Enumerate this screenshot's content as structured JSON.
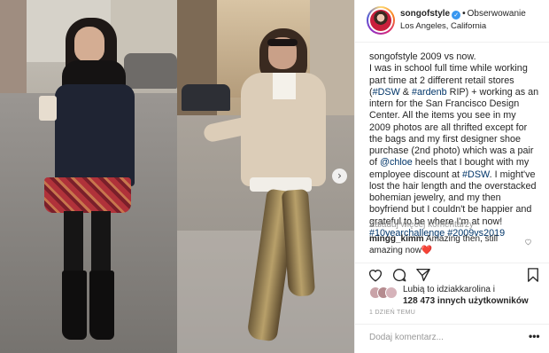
{
  "post": {
    "username": "songofstyle",
    "follow_label": "Obserwowanie",
    "location": "Los Angeles, California",
    "caption_lines": [
      {
        "parts": [
          {
            "t": "songofstyle 2009 vs now."
          }
        ]
      },
      {
        "parts": [
          {
            "t": "I was in school full time while working"
          }
        ]
      },
      {
        "parts": [
          {
            "t": "part time at 2 different retail stores"
          }
        ]
      },
      {
        "parts": [
          {
            "t": "("
          },
          {
            "t": "#DSW",
            "link": true
          },
          {
            "t": " & "
          },
          {
            "t": "#ardenb",
            "link": true
          },
          {
            "t": " RIP) + working as an"
          }
        ]
      },
      {
        "parts": [
          {
            "t": "intern for the San Francisco Design"
          }
        ]
      },
      {
        "parts": [
          {
            "t": "Center. All the items you see in my"
          }
        ]
      },
      {
        "parts": [
          {
            "t": "2009 photos are all thrifted except for"
          }
        ]
      },
      {
        "parts": [
          {
            "t": "the bags and my first designer shoe"
          }
        ]
      },
      {
        "parts": [
          {
            "t": "purchase (2nd photo) which was a pair"
          }
        ]
      },
      {
        "parts": [
          {
            "t": "of "
          },
          {
            "t": "@chloe",
            "link": true
          },
          {
            "t": " heels that I bought with my"
          }
        ]
      },
      {
        "parts": [
          {
            "t": "employee discount at "
          },
          {
            "t": "#DSW",
            "link": true
          },
          {
            "t": ". I might've"
          }
        ]
      },
      {
        "parts": [
          {
            "t": "lost the hair length and the overstacked"
          }
        ]
      },
      {
        "parts": [
          {
            "t": "bohemian jewelry, and my then"
          }
        ]
      },
      {
        "parts": [
          {
            "t": "boyfriend but I couldn't be happier and"
          }
        ]
      },
      {
        "parts": [
          {
            "t": "grateful to be where I'm at now!"
          }
        ]
      },
      {
        "parts": [
          {
            "t": "#10yearchallenge",
            "link": true
          },
          {
            "t": " "
          },
          {
            "t": "#2009vs2019",
            "link": true
          }
        ]
      }
    ],
    "load_more_label": "Załaduj więcej komentarzy",
    "comment": {
      "user": "mingg_kimm",
      "text_line1": "Amazing then, still",
      "text_line2": "amazing now",
      "emoji": "❤️"
    },
    "likes_line1": "Lubią to idziakkarolina i",
    "likes_line2": "128 473 innych użytkowników",
    "timestamp": "1 DZIEŃ TEMU",
    "comment_placeholder": "Dodaj komentarz...",
    "options_glyph": "•••"
  },
  "icons": {
    "like": "heart-icon",
    "comment": "comment-bubble-icon",
    "share": "share-arrow-icon",
    "save": "bookmark-icon",
    "verified": "verified-badge-icon",
    "carousel_next": "chevron-right-icon"
  },
  "colors": {
    "link": "#003569",
    "muted": "#999999",
    "verified": "#3897f0",
    "text": "#262626"
  }
}
